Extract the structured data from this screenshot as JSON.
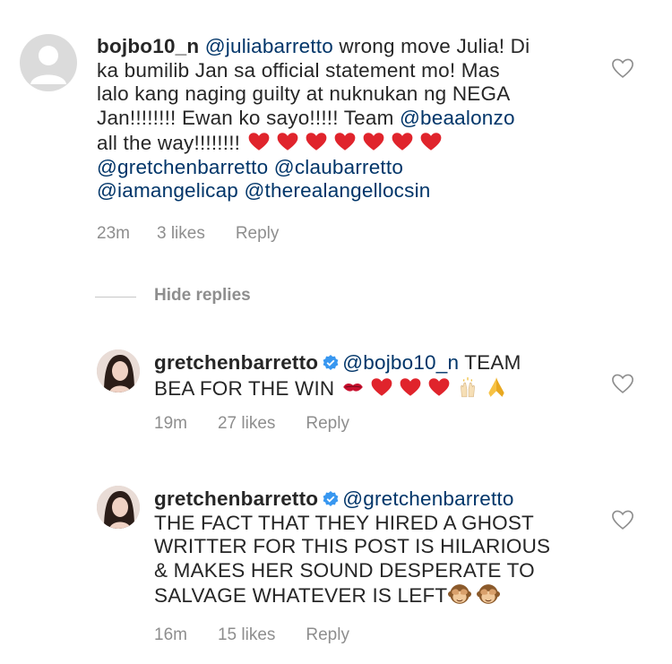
{
  "comments": [
    {
      "username": "bojbo10_n",
      "lines": [
        [
          "@juliabarretto",
          " wrong move Julia! Di"
        ],
        [
          "",
          "ka bumilib Jan sa official statement mo! Mas"
        ],
        [
          "",
          "lalo kang naging guilty at nuknukan ng NEGA"
        ],
        [
          "",
          "Jan!!!!!!!! Ewan ko sayo!!!!! Team "
        ],
        [
          "",
          "all the way!!!!!!!! "
        ],
        [
          "@gretchenbarretto @claubarretto",
          ""
        ],
        [
          "@iamangelicap @therealangellocsin",
          ""
        ]
      ],
      "mention_bea": "@beaalonzo",
      "time": "23m",
      "likes": "3 likes",
      "reply": "Reply"
    },
    {
      "username": "gretchenbarretto",
      "line1_mention": "@bojbo10_n",
      "line1_text": " TEAM",
      "line2_text": "BEA FOR THE WIN ",
      "time": "19m",
      "likes": "27 likes",
      "reply": "Reply"
    },
    {
      "username": "gretchenbarretto",
      "line1_mention": "@gretchenbarretto",
      "lines": [
        "THE FACT THAT THEY HIRED A GHOST",
        "WRITTER FOR THIS POST IS HILARIOUS",
        "& MAKES HER SOUND DESPERATE TO",
        "SALVAGE WHATEVER IS LEFT"
      ],
      "time": "16m",
      "likes": "15 likes",
      "reply": "Reply"
    }
  ],
  "hide_replies": "Hide replies",
  "colors": {
    "mention": "#003569",
    "meta": "#8e8e8e",
    "heart_red": "#e0242c",
    "verified": "#3897f0"
  },
  "icons": [
    "heart-outline-icon",
    "verified-badge-icon",
    "red-heart-emoji",
    "kiss-mark-emoji",
    "raising-hands-emoji",
    "folded-hands-emoji",
    "see-no-evil-monkey-emoji"
  ]
}
